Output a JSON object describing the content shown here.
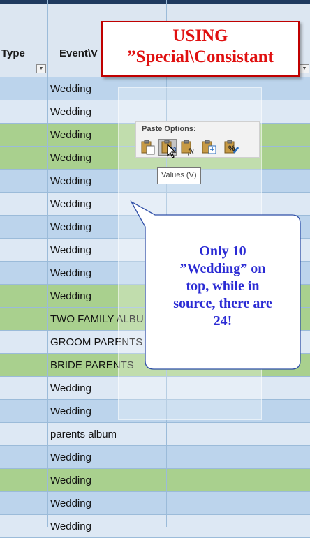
{
  "columns": [
    {
      "header": "Type"
    },
    {
      "header": "Event\\V"
    }
  ],
  "rows": [
    {
      "text": "Wedding",
      "color": "#bcd4ec"
    },
    {
      "text": "Wedding",
      "color": "#dde8f4"
    },
    {
      "text": "Wedding",
      "color": "#a9d08e"
    },
    {
      "text": "Wedding",
      "color": "#a9d08e"
    },
    {
      "text": "Wedding",
      "color": "#bcd4ec"
    },
    {
      "text": "Wedding",
      "color": "#dde8f4"
    },
    {
      "text": "Wedding",
      "color": "#bcd4ec"
    },
    {
      "text": "Wedding",
      "color": "#dde8f4"
    },
    {
      "text": "Wedding",
      "color": "#bcd4ec"
    },
    {
      "text": "Wedding",
      "color": "#a9d08e"
    },
    {
      "text": "TWO FAMILY ALBU",
      "color": "#a9d08e"
    },
    {
      "text": "GROOM PARENTS",
      "color": "#dde8f4"
    },
    {
      "text": "BRIDE PARENTS",
      "color": "#a9d08e"
    },
    {
      "text": "Wedding",
      "color": "#dde8f4"
    },
    {
      "text": "Wedding",
      "color": "#bcd4ec"
    },
    {
      "text": "parents album",
      "color": "#dde8f4"
    },
    {
      "text": "Wedding",
      "color": "#bcd4ec"
    },
    {
      "text": "Wedding",
      "color": "#a9d08e"
    },
    {
      "text": "Wedding",
      "color": "#bcd4ec"
    },
    {
      "text": "Wedding",
      "color": "#dde8f4"
    }
  ],
  "paste_menu": {
    "title": "Paste Options:",
    "buttons": [
      {
        "icon": "paste-icon"
      },
      {
        "icon": "paste-values-icon",
        "selected": true
      },
      {
        "icon": "paste-formulas-icon"
      },
      {
        "icon": "paste-link-icon"
      },
      {
        "icon": "paste-formatting-icon"
      }
    ],
    "tooltip": "Values (V)"
  },
  "annotation_title": {
    "line1": "USING",
    "line2": "”Special\\Consistant"
  },
  "callout": {
    "lines": [
      "Only 10",
      "”Wedding” on",
      "top, while in",
      "source, there are",
      "24!"
    ]
  }
}
